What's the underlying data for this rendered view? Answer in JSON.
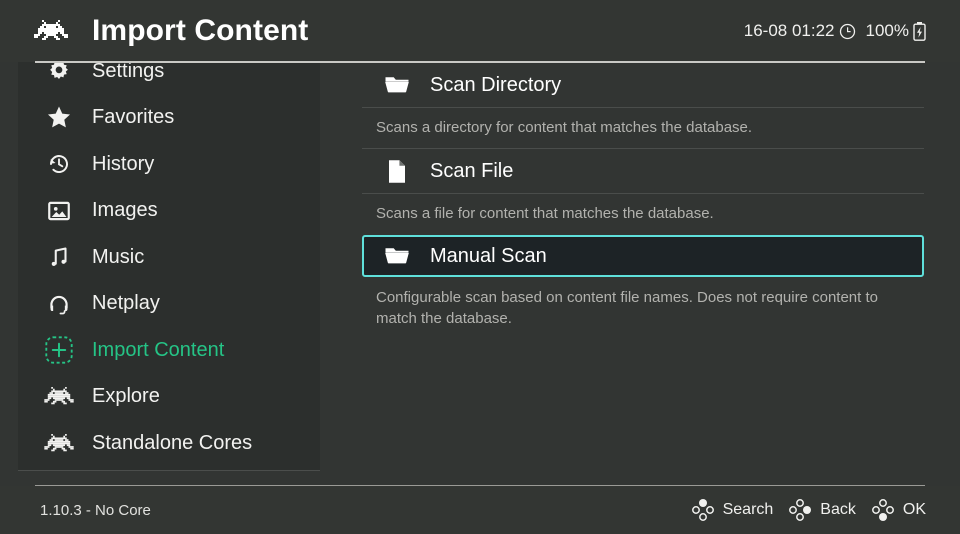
{
  "header": {
    "icon": "invader-icon",
    "title": "Import Content",
    "datetime": "16-08 01:22",
    "clock_icon": "clock-icon",
    "battery_percent": "100%",
    "battery_icon": "battery-charging-icon"
  },
  "sidebar": {
    "items": [
      {
        "label": "Settings",
        "icon": "gear-icon",
        "active": false
      },
      {
        "label": "Favorites",
        "icon": "star-icon",
        "active": false
      },
      {
        "label": "History",
        "icon": "history-icon",
        "active": false
      },
      {
        "label": "Images",
        "icon": "image-icon",
        "active": false
      },
      {
        "label": "Music",
        "icon": "music-icon",
        "active": false
      },
      {
        "label": "Netplay",
        "icon": "netplay-icon",
        "active": false
      },
      {
        "label": "Import Content",
        "icon": "plus-box-icon",
        "active": true
      },
      {
        "label": "Explore",
        "icon": "invader-icon",
        "active": false
      },
      {
        "label": "Standalone Cores",
        "icon": "invader-icon",
        "active": false
      }
    ]
  },
  "main": {
    "entries": [
      {
        "label": "Scan Directory",
        "icon": "folder-icon",
        "description": "Scans a directory for content that matches the database.",
        "selected": false
      },
      {
        "label": "Scan File",
        "icon": "file-icon",
        "description": "Scans a file for content that matches the database.",
        "selected": false
      },
      {
        "label": "Manual Scan",
        "icon": "folder-icon",
        "description": "Configurable scan based on content file names. Does not require content to match the database.",
        "selected": true
      }
    ]
  },
  "footer": {
    "version": "1.10.3 - No Core",
    "hints": [
      {
        "label": "Search",
        "icon": "pad-up-icon"
      },
      {
        "label": "Back",
        "icon": "pad-right-icon"
      },
      {
        "label": "OK",
        "icon": "pad-down-icon"
      }
    ]
  },
  "colors": {
    "background": "#323533",
    "panel": "#2c2f2d",
    "accent_green": "#25c486",
    "accent_cyan": "#5fe0db",
    "selected_fill": "#1d2326",
    "text": "#ffffff",
    "text_muted": "#b2b2ae"
  }
}
